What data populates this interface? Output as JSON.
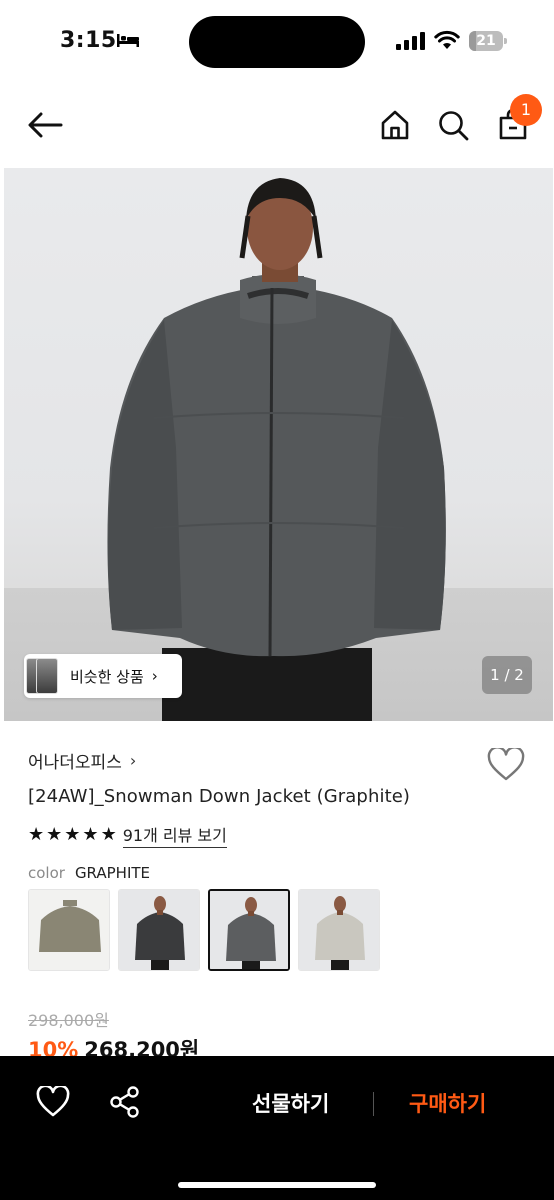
{
  "status_bar": {
    "time": "3:15",
    "battery_percent": "21",
    "battery_level": 0.21,
    "icons": [
      "sleep-bed-icon",
      "signal-icon",
      "wifi-icon",
      "battery-icon"
    ]
  },
  "header": {
    "icons": [
      "back-arrow-icon",
      "home-icon",
      "search-icon",
      "shopping-bag-icon"
    ],
    "cart_count": "1"
  },
  "gallery": {
    "similar_label": "비슷한 상품",
    "page_indicator": "1 / 2"
  },
  "product": {
    "brand": "어나더오피스",
    "name": "[24AW]_Snowman Down Jacket (Graphite)",
    "rating": 5,
    "review_link": "91개 리뷰 보기",
    "color_label": "color",
    "color_value": "GRAPHITE",
    "original_price": "298,000원",
    "discount": "10%",
    "sale_price": "268,200원"
  },
  "swatches": [
    {
      "name": "khaki",
      "color": "#8a8674",
      "selected": false
    },
    {
      "name": "charcoal",
      "color": "#3a3b3d",
      "selected": false
    },
    {
      "name": "graphite",
      "color": "#5c5e60",
      "selected": true
    },
    {
      "name": "light-grey",
      "color": "#c9c7bf",
      "selected": false
    }
  ],
  "bottom_bar": {
    "gift_label": "선물하기",
    "buy_label": "구매하기"
  },
  "colors": {
    "accent": "#ff5a14",
    "jacket": "#55585a",
    "background": "#ffffff"
  }
}
